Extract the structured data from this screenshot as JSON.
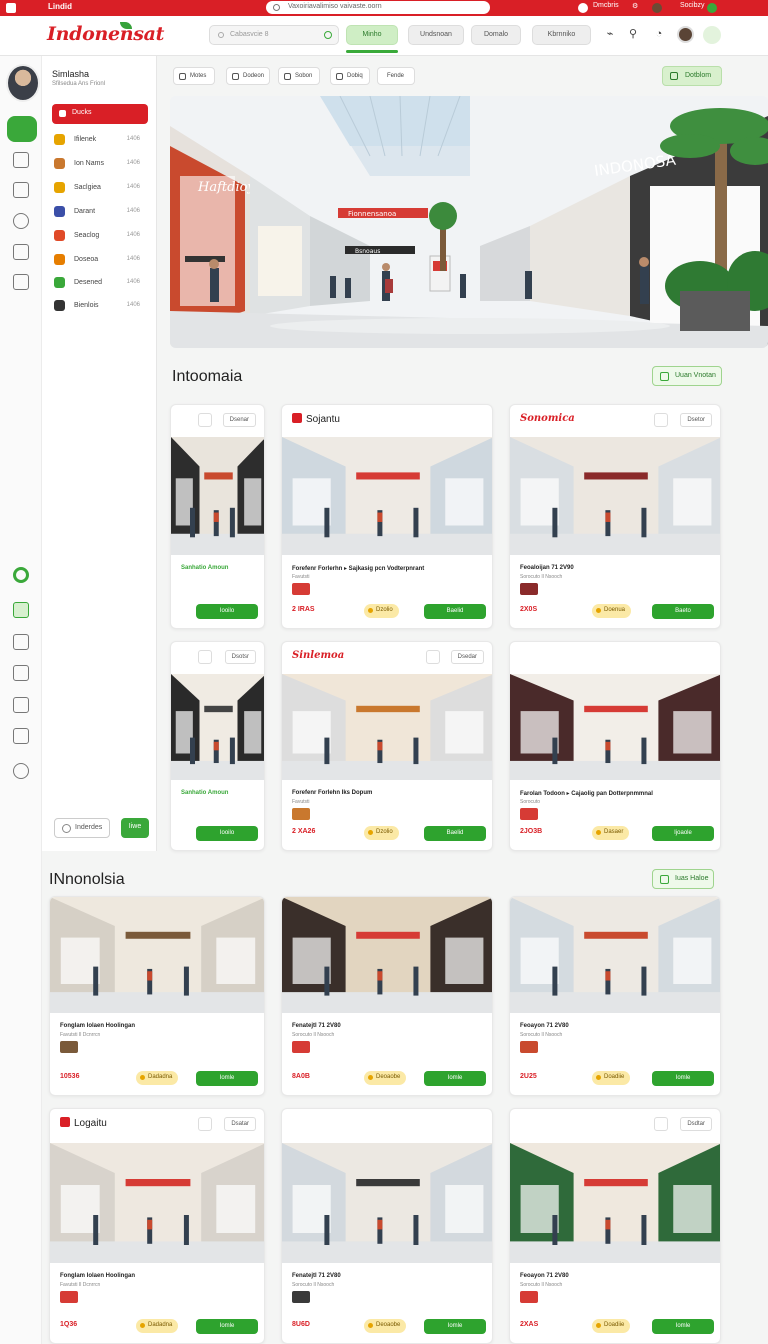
{
  "topbar": {
    "brand": "Lindid",
    "url": "Vaxoiriavalimiso vaivaste.oorn",
    "right_label": "Dmcbris",
    "right_label2": "Socibzy"
  },
  "header": {
    "logo": "Indonensat",
    "search_placeholder": "Cabasvcie 8",
    "nav": [
      "Minho",
      "Undsnoan",
      "Domalo",
      "Kbrnniko"
    ]
  },
  "profile": {
    "name": "Simlasha",
    "subtitle": "Sfilsedua Ans Frionl"
  },
  "sidebar": {
    "active": "Ducks",
    "items": [
      {
        "label": "Ifilenek",
        "count": "1406",
        "color": "#e6a400"
      },
      {
        "label": "Ion Nams",
        "count": "1406",
        "color": "#c9782e"
      },
      {
        "label": "Saclgiea",
        "count": "1406",
        "color": "#e6a400"
      },
      {
        "label": "Darant",
        "count": "1406",
        "color": "#3b4fa8"
      },
      {
        "label": "Seaclog",
        "count": "1406",
        "color": "#e04a28"
      },
      {
        "label": "Doseoa",
        "count": "1406",
        "color": "#e67e00"
      },
      {
        "label": "Desened",
        "count": "1406",
        "color": "#3aa83a"
      },
      {
        "label": "Bienlois",
        "count": "1406",
        "color": "#333333"
      }
    ],
    "footer_btn": "Inderdes",
    "footer_btn2": "Iiwe"
  },
  "toolbar": {
    "buttons": [
      "Motes",
      "Dodeon",
      "Sobon",
      "Dobiq",
      "Fende"
    ],
    "new_label": "Dotblom"
  },
  "hero": {
    "store_left": "Haftdioy",
    "store_right": "INDONOSA",
    "banner": "Fionnensanoa",
    "center_sign": "Bsnoaus"
  },
  "sections": [
    {
      "title": "Intoomaia",
      "view": "Uuan Vnotan"
    },
    {
      "title": "INnonolsia",
      "view": "Iuas Haloe"
    }
  ],
  "cards": [
    {
      "brand": "",
      "mini": "Dsenar",
      "store": "Elddoosa",
      "title": "Sanhatio Amoun",
      "title_green": true,
      "meta": "",
      "price": "",
      "tag": "",
      "buy": "Iooilo"
    },
    {
      "brand": "Sojantu",
      "brand_style": "box",
      "mini": "",
      "store": "",
      "title": "Forefenr Forlerhn  ▸  Sajkasig pcn Vodterpnrant",
      "title_green": false,
      "meta": "Favutsti",
      "price": "2 IRAS",
      "tag": "Dzolio",
      "buy": "Baelid"
    },
    {
      "brand": "Sonomica",
      "brand_style": "red",
      "mini": "Dsetor",
      "store": "",
      "title": "Feoaloijan 71 2V90",
      "title_green": false,
      "meta": "Sorocuto Il Nsooch",
      "price": "2X0S",
      "tag": "Doenua",
      "buy": "Baeto"
    },
    {
      "brand": "",
      "mini": "Dsotsr",
      "store": "Fasoro",
      "title": "Sanhatio Amoun",
      "title_green": true,
      "meta": "",
      "price": "",
      "tag": "",
      "buy": "Iooilo"
    },
    {
      "brand": "Sinlemoa",
      "brand_style": "red",
      "mini": "Dsedar",
      "store": "",
      "title": "Forefenr Forlehn  Iks Dopum",
      "title_green": false,
      "meta": "Favutsti",
      "price": "2 XA26",
      "tag": "Dzolio",
      "buy": "Baelid"
    },
    {
      "brand": "",
      "mini": "",
      "store": "Odnoel",
      "title": "Farolan Todoon  ▸  Cajaolig pan Dotterpnmmnal",
      "title_green": false,
      "meta": "Sorocuto",
      "price": "2JO3B",
      "tag": "Dasaer",
      "buy": "Ijoaole"
    },
    {
      "brand": "",
      "mini": "",
      "store": "",
      "title": "Fonglam Iolaen  Hoolingan",
      "title_green": false,
      "meta": "Favutsti Il Dcnrrcn",
      "price": "10536",
      "tag": "Dadadna",
      "buy": "Iomle"
    },
    {
      "brand": "",
      "mini": "",
      "store": "",
      "title": "Fenatejtl 71 2V80",
      "title_green": false,
      "meta": "Sorocuto Il Nsooch",
      "price": "8A0B",
      "tag": "Deoaobe",
      "buy": "Iomle"
    },
    {
      "brand": "",
      "mini": "",
      "store": "",
      "title": "Feoayon 71 2V80",
      "title_green": false,
      "meta": "Sorocuto Il Nsooch",
      "price": "2U25",
      "tag": "Doadiie",
      "buy": "Iomle"
    },
    {
      "brand": "Logaitu",
      "brand_style": "logo",
      "mini": "Dsatar",
      "store": "",
      "title": "Fonglam Iolaen  Hoolingan",
      "title_green": false,
      "meta": "Favutsti Il Dcnrrcn",
      "price": "1Q36",
      "tag": "Dadadna",
      "buy": "Iomle"
    },
    {
      "brand": "",
      "mini": "",
      "store": "",
      "title": "Fenatejtl 71 2V80",
      "title_green": false,
      "meta": "Sorocuto Il Nsooch",
      "price": "8U6D",
      "tag": "Deoaobe",
      "buy": "Iomle"
    },
    {
      "brand": "",
      "mini": "Dsdtar",
      "store": "",
      "title": "Feoayon 71 2V80",
      "title_green": false,
      "meta": "Sorocuto Il Nsooch",
      "price": "2XAS",
      "tag": "Doadiie",
      "buy": "Iomle"
    }
  ],
  "colors": {
    "brand_red": "#d91f26",
    "accent_green": "#3aa83a"
  }
}
